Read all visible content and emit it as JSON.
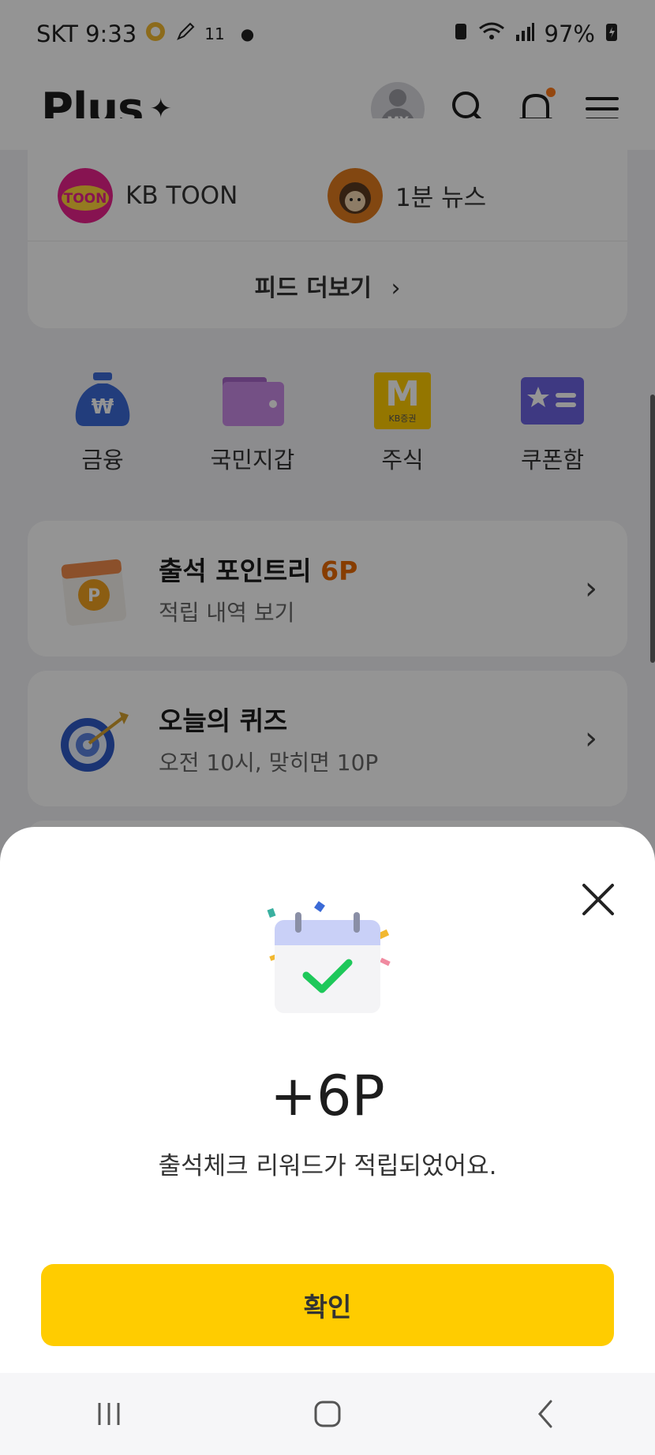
{
  "status_bar": {
    "time": "SKT 9:33",
    "extra": "11",
    "battery": "97%"
  },
  "header": {
    "logo": "Plus",
    "avatar_label": "MY"
  },
  "feed": {
    "items": [
      {
        "label": "KB TOON",
        "icon": "kb-toon-icon"
      },
      {
        "label": "1분 뉴스",
        "icon": "hedgehog-news-icon"
      }
    ],
    "more_label": "피드 더보기",
    "more_chevron": "›"
  },
  "quick_menu": [
    {
      "label": "금융",
      "icon": "money-bag-icon"
    },
    {
      "label": "국민지갑",
      "icon": "wallet-icon"
    },
    {
      "label": "주식",
      "icon": "kb-stock-icon"
    },
    {
      "label": "쿠폰함",
      "icon": "coupon-icon"
    }
  ],
  "quick_stock_letter": "M",
  "quick_stock_sub": "KB증권",
  "attendance": {
    "title": "출석 포인트리",
    "points": "6P",
    "subtitle": "적립 내역 보기",
    "chevron": "›"
  },
  "quiz": {
    "title": "오늘의 퀴즈",
    "subtitle": "오전 10시, 맞히면 10P",
    "chevron": "›"
  },
  "sheet": {
    "points": "+6P",
    "message": "출석체크 리워드가 적립되었어요.",
    "confirm_label": "확인"
  },
  "colors": {
    "accent": "#ffcc00",
    "point_orange": "#e86a00",
    "check_green": "#1ec85a"
  }
}
